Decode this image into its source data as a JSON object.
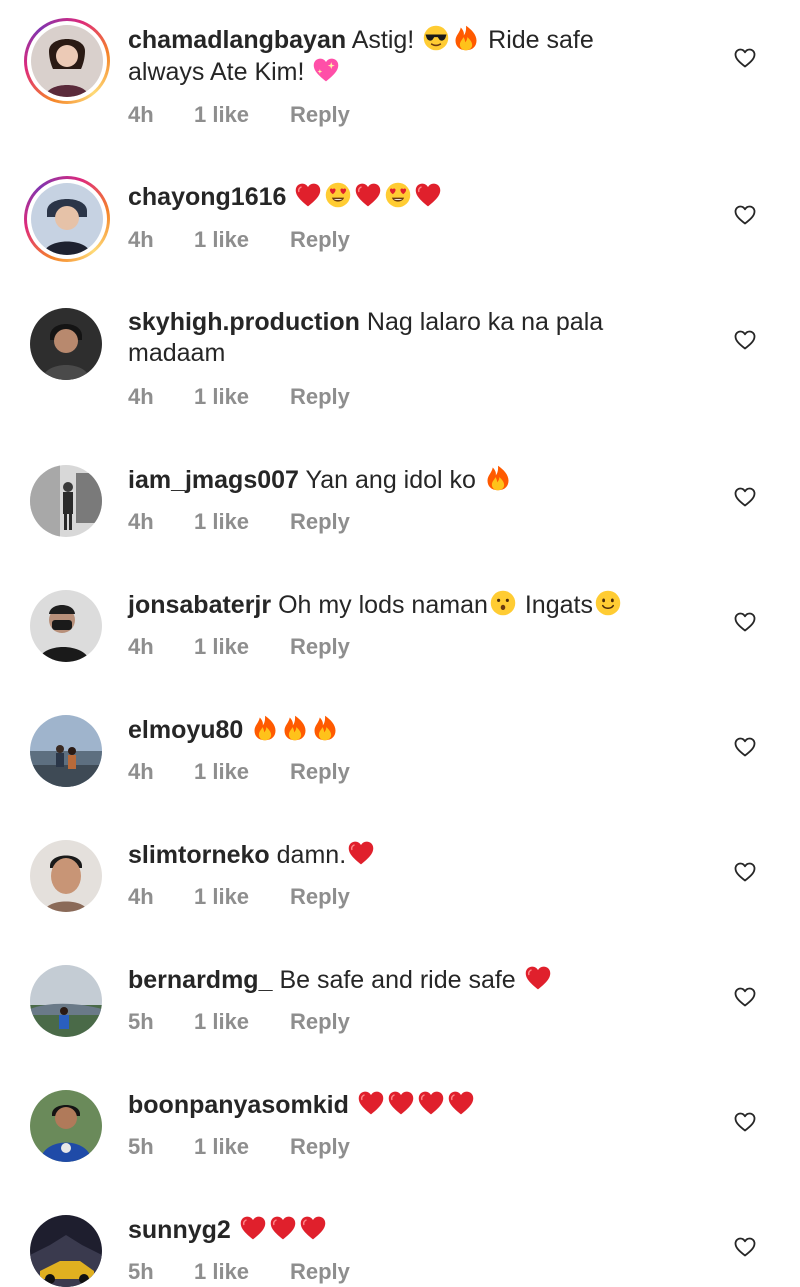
{
  "comments": [
    {
      "username": "chamadlangbayan",
      "text": "Astig!",
      "text_after": "Ride safe",
      "line2": "always Ate Kim!",
      "time": "4h",
      "likes": "1 like",
      "reply": "Reply",
      "avatar_color": "#6a4a48",
      "story": true
    },
    {
      "username": "chayong1616",
      "text": "",
      "time": "4h",
      "likes": "1 like",
      "reply": "Reply",
      "avatar_color": "#5b6b8a",
      "story": true
    },
    {
      "username": "skyhigh.production",
      "text": "Nag lalaro ka na pala",
      "line2": "madaam",
      "time": "4h",
      "likes": "1 like",
      "reply": "Reply",
      "avatar_color": "#3b3b3b",
      "story": false
    },
    {
      "username": "iam_jmags007",
      "text": "Yan ang idol ko",
      "time": "4h",
      "likes": "1 like",
      "reply": "Reply",
      "avatar_color": "#9a9a9a",
      "story": false
    },
    {
      "username": "jonsabaterjr",
      "text": "Oh my lods naman",
      "text_after": "Ingats",
      "time": "4h",
      "likes": "1 like",
      "reply": "Reply",
      "avatar_color": "#4a4a4a",
      "story": false
    },
    {
      "username": "elmoyu80",
      "text": "",
      "time": "4h",
      "likes": "1 like",
      "reply": "Reply",
      "avatar_color": "#6f8aa8",
      "story": false
    },
    {
      "username": "slimtorneko",
      "text": "damn.",
      "time": "4h",
      "likes": "1 like",
      "reply": "Reply",
      "avatar_color": "#b08a70",
      "story": false
    },
    {
      "username": "bernardmg_",
      "text": "Be safe and ride safe",
      "time": "5h",
      "likes": "1 like",
      "reply": "Reply",
      "avatar_color": "#7a8a99",
      "story": false
    },
    {
      "username": "boonpanyasomkid",
      "text": "",
      "time": "5h",
      "likes": "1 like",
      "reply": "Reply",
      "avatar_color": "#3a5ea8",
      "story": false
    },
    {
      "username": "sunnyg2",
      "text": "",
      "time": "5h",
      "likes": "1 like",
      "reply": "Reply",
      "avatar_color": "#2a2a3a",
      "story": false
    }
  ],
  "colors": {
    "text": "#262626",
    "meta": "#8e8e8e",
    "heart_red": "#e0202c",
    "fire_orange": "#ff6a00"
  }
}
